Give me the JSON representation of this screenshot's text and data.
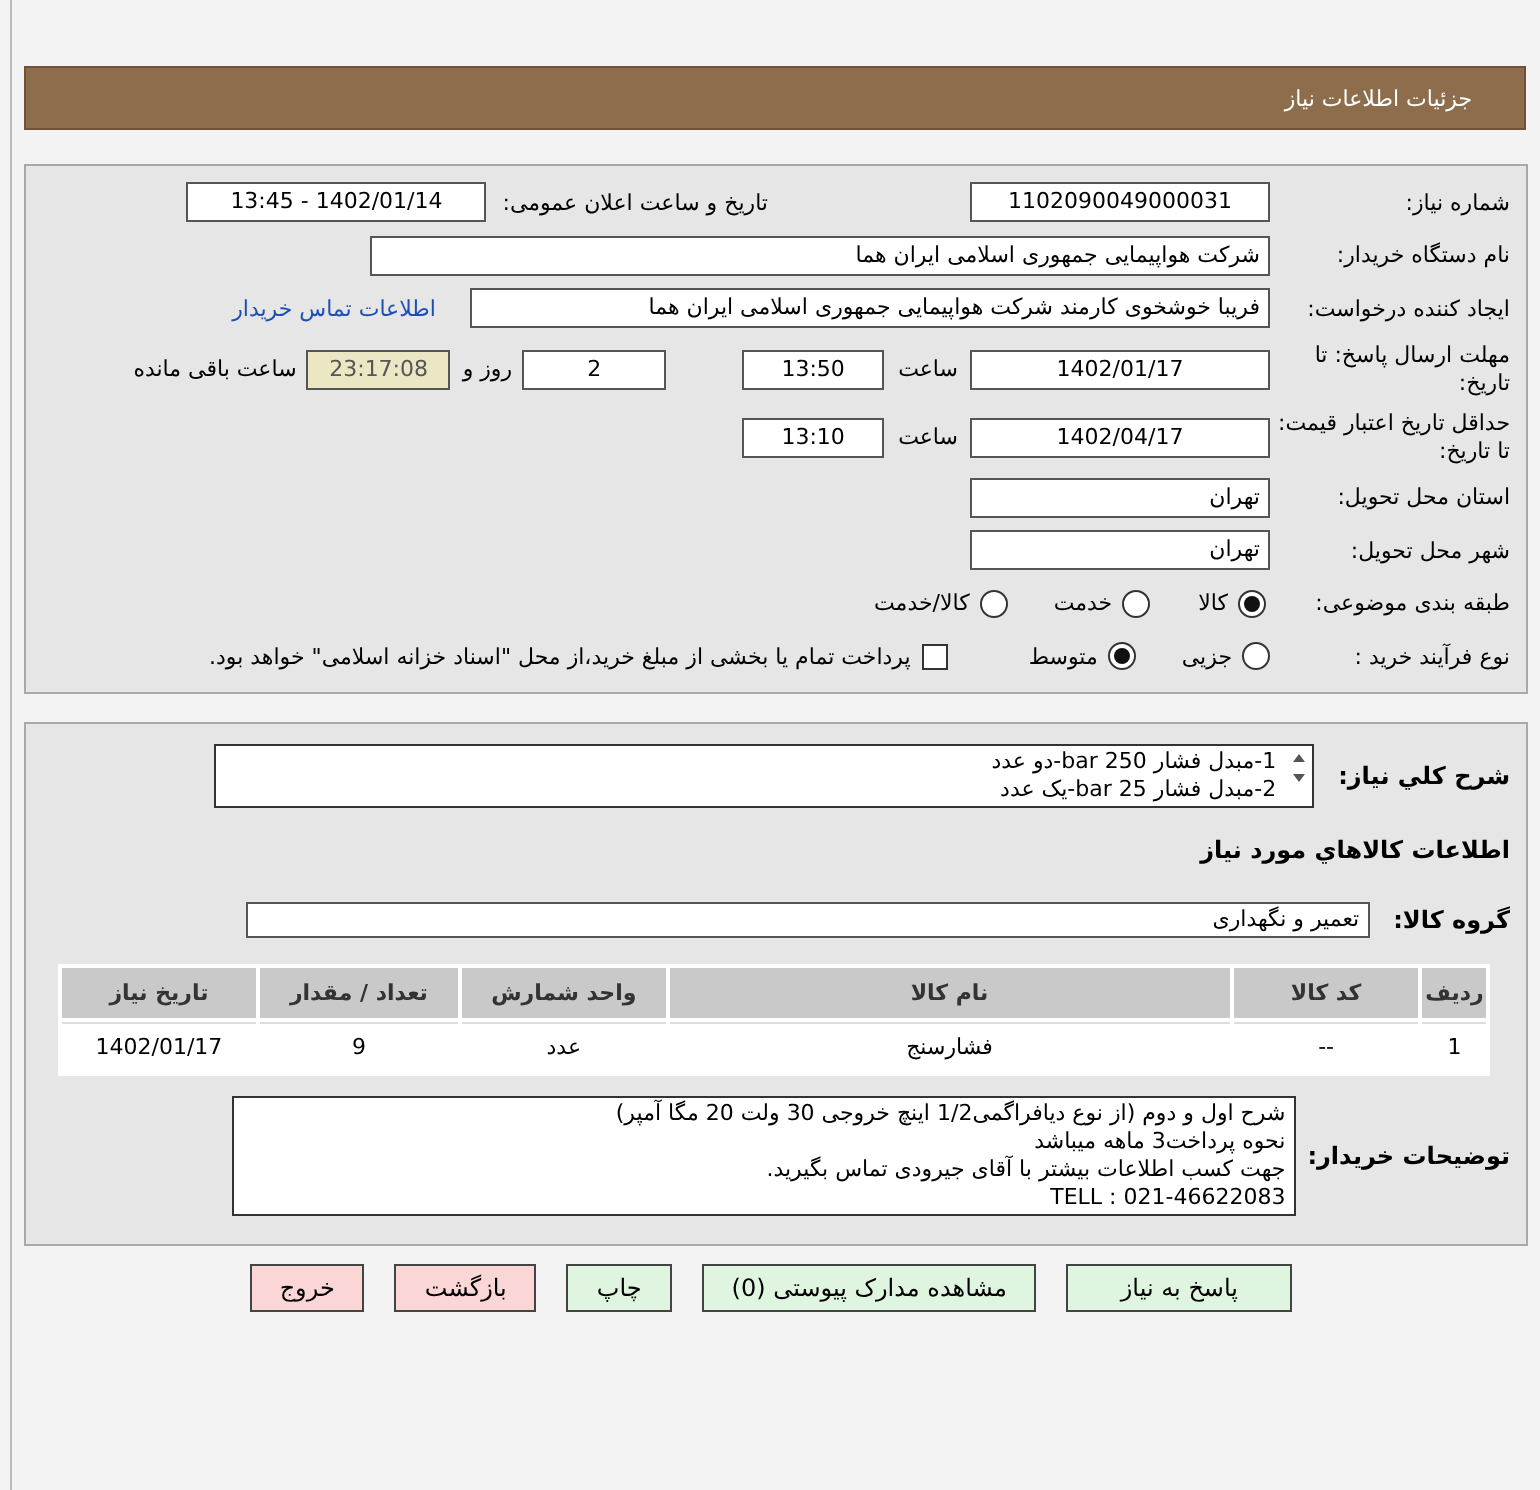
{
  "header": {
    "title": "جزئیات اطلاعات نیاز"
  },
  "info": {
    "need_number": {
      "label": "شماره نیاز:",
      "value": "1102090049000031"
    },
    "announce": {
      "label": "تاریخ و ساعت اعلان عمومی:",
      "value": "1402/01/14 - 13:45"
    },
    "buyer": {
      "label": "نام دستگاه خریدار:",
      "value": "شرکت هواپیمایی جمهوری اسلامی ایران هما"
    },
    "requester": {
      "label": "ایجاد کننده درخواست:",
      "value": "فریبا خوشخوی کارمند شرکت هواپیمایی جمهوری اسلامی ایران هما",
      "link": "اطلاعات تماس خریدار"
    },
    "deadline": {
      "label": "مهلت ارسال پاسخ: تا تاریخ:",
      "date": "1402/01/17",
      "time_label": "ساعت",
      "time": "13:50",
      "days": "2",
      "days_label": "روز و",
      "remaining": "23:17:08",
      "remaining_label": "ساعت باقی مانده"
    },
    "validity": {
      "label": "حداقل تاریخ اعتبار قیمت: تا تاریخ:",
      "date": "1402/04/17",
      "time_label": "ساعت",
      "time": "13:10"
    },
    "province": {
      "label": "استان محل تحویل:",
      "value": "تهران"
    },
    "city": {
      "label": "شهر محل تحویل:",
      "value": "تهران"
    },
    "category": {
      "label": "طبقه بندی موضوعی:",
      "options": [
        {
          "label": "کالا",
          "selected": true
        },
        {
          "label": "خدمت",
          "selected": false
        },
        {
          "label": "کالا/خدمت",
          "selected": false
        }
      ]
    },
    "process": {
      "label": "نوع فرآیند خرید :",
      "options": [
        {
          "label": "جزیی",
          "selected": false
        },
        {
          "label": "متوسط",
          "selected": true
        }
      ],
      "payment": {
        "label": "پرداخت تمام یا بخشی از مبلغ خرید،از محل \"اسناد خزانه اسلامی\" خواهد بود.",
        "checked": false
      }
    }
  },
  "goods": {
    "summary": {
      "label": "شرح کلي نياز:",
      "lines": [
        "1-مبدل فشار bar 250-دو عدد",
        "2-مبدل فشار bar 25-یک عدد"
      ]
    },
    "title": "اطلاعات کالاهاي مورد نياز",
    "group": {
      "label": "گروه کالا:",
      "value": "تعمیر و نگهداری"
    },
    "table": {
      "columns": [
        "ردیف",
        "کد کالا",
        "نام کالا",
        "واحد شمارش",
        "تعداد / مقدار",
        "تاریخ نیاز"
      ],
      "rows": [
        [
          "1",
          "--",
          "فشارسنج",
          "عدد",
          "9",
          "1402/01/17"
        ]
      ]
    },
    "notes": {
      "label": "توضیحات خریدار:",
      "lines": [
        "شرح اول و دوم (از نوع دیافراگمی1/2 اینچ خروجی 30 ولت 20 مگا آمپر)",
        "نحوه پرداخت3 ماهه میباشد",
        "جهت کسب اطلاعات بیشتر با آقای جیرودی تماس بگیرید.",
        "TELL : 021-46622083"
      ]
    }
  },
  "buttons": [
    {
      "label": "پاسخ به نیاز",
      "kind": "normal"
    },
    {
      "label": "مشاهده مدارک پیوستی (0)",
      "kind": "normal"
    },
    {
      "label": "چاپ",
      "kind": "normal"
    },
    {
      "label": "بازگشت",
      "kind": "danger"
    },
    {
      "label": "خروج",
      "kind": "danger"
    }
  ]
}
